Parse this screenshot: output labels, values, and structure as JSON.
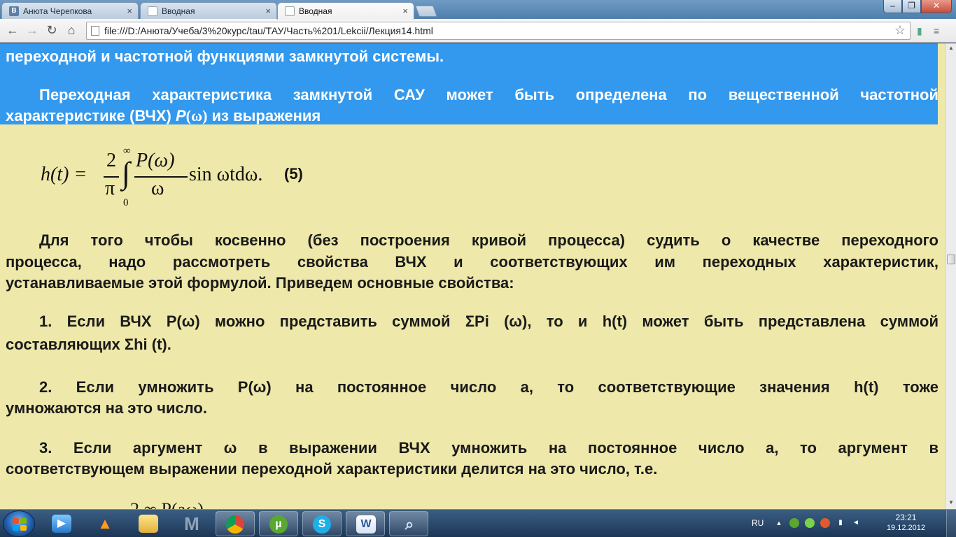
{
  "browser": {
    "tabs": [
      {
        "label": "Анюта Черепкова",
        "icon": "vk-icon",
        "icon_text": "B",
        "active": false
      },
      {
        "label": "Вводная",
        "icon": "document-icon",
        "active": false
      },
      {
        "label": "Вводная",
        "icon": "document-icon",
        "active": true
      }
    ],
    "tab_close": "×",
    "window_buttons": {
      "minimize": "–",
      "maximize": "❐",
      "close": "✕"
    },
    "nav": {
      "back": "←",
      "forward": "→",
      "reload": "↻",
      "home": "⌂"
    },
    "url": "file:///D:/Анюта/Учеба/3%20курс/tau/ТАУ/Часть%201/Lekcii/Лекция14.html",
    "bookmark_star": "☆"
  },
  "document": {
    "selected_line1": "переходной и частотной функциями замкнутой системы.",
    "para1_line1": "Переходная характеристика замкнутой САУ может быть определена по вещественной частотной",
    "para1_line2_a": "характеристике (ВЧХ) ",
    "para1_line2_P": "P",
    "para1_line2_omega": "(ω)",
    "para1_line2_b": " из выражения",
    "formula": {
      "lhs": "h(t) =",
      "frac_num": "2",
      "frac_den": "π",
      "int_upper": "∞",
      "int_lower": "0",
      "integrand_num": "P(ω)",
      "integrand_den": "ω",
      "rest": "sin ωtdω.",
      "number": "(5)"
    },
    "para2_line1": "Для того чтобы косвенно (без построения кривой процесса) судить о качестве переходного",
    "para2_line2": "процесса, надо рассмотреть свойства ВЧХ и соответствующих им переходных характеристик,",
    "para2_line3": "устанавливаемые этой формулой. Приведем основные свойства:",
    "prop1_line1": "1. Если ВЧХ P(ω) можно представить суммой ΣPi (ω), то и h(t) может быть представлена суммой",
    "prop1_line2": "составляющих Σhi (t).",
    "prop2_line1": "2. Если умножить P(ω) на постоянное число a, то соответствующие значения h(t) тоже",
    "prop2_line2": "умножаются на это число.",
    "prop3_line1": "3. Если аргумент ω в выражении ВЧХ умножить на постоянное число a, то аргумент в",
    "prop3_line2": "соответствующем выражении переходной характеристики делится на это число, т.е.",
    "next_formula_partial": "2 ∞ P(aω)"
  },
  "taskbar": {
    "apps": [
      {
        "name": "media-player",
        "icon": "media-player-icon",
        "open": false
      },
      {
        "name": "vlc",
        "icon": "vlc-icon",
        "open": false
      },
      {
        "name": "explorer",
        "icon": "folder-icon",
        "open": false
      },
      {
        "name": "mathcad",
        "icon": "mathcad-icon",
        "open": false,
        "icon_text": "M"
      },
      {
        "name": "chrome",
        "icon": "chrome-icon",
        "open": true
      },
      {
        "name": "utorrent",
        "icon": "utorrent-icon",
        "open": true
      },
      {
        "name": "skype",
        "icon": "skype-icon",
        "open": true
      },
      {
        "name": "word",
        "icon": "word-icon",
        "open": true,
        "icon_text": "W"
      },
      {
        "name": "magnifier",
        "icon": "magnifier-icon",
        "open": true
      }
    ],
    "tray": {
      "lang": "RU",
      "up_arrow": "▲",
      "time": "23:21",
      "date": "19.12.2012"
    }
  },
  "colors": {
    "page_bg": "#eee8aa",
    "selection": "#3399ee",
    "taskbar": "#1c3656"
  }
}
